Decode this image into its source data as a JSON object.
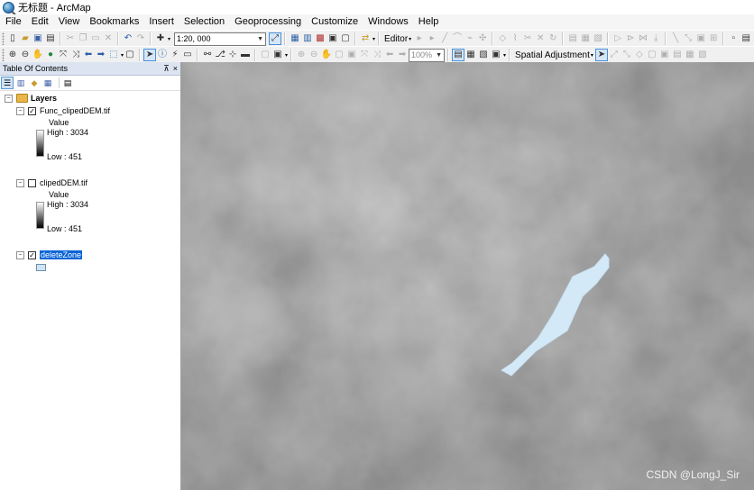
{
  "window": {
    "title": "无标题 - ArcMap"
  },
  "menu": [
    "File",
    "Edit",
    "View",
    "Bookmarks",
    "Insert",
    "Selection",
    "Geoprocessing",
    "Customize",
    "Windows",
    "Help"
  ],
  "toolbar": {
    "scale": "1:20, 000",
    "editor_label": "Editor",
    "zoom_percent": "100%",
    "spatial_adjustment_label": "Spatial Adjustment"
  },
  "toc": {
    "title": "Table Of Contents",
    "pin": "ᵖ",
    "close": "×",
    "root": "Layers",
    "layers": [
      {
        "name": "Func_clipedDEM.tif",
        "checked": true,
        "field": "Value",
        "high": "High : 3034",
        "low": "Low : 451"
      },
      {
        "name": "clipedDEM.tif",
        "checked": false,
        "field": "Value",
        "high": "High : 3034",
        "low": "Low : 451"
      },
      {
        "name": "deleteZone",
        "checked": true,
        "symbol_color": "#cfe5f4"
      }
    ]
  },
  "map": {
    "polygon_fill": "#d4e9f7",
    "background": "#6a6a6a",
    "watermark": "CSDN @LongJ_Sir"
  }
}
